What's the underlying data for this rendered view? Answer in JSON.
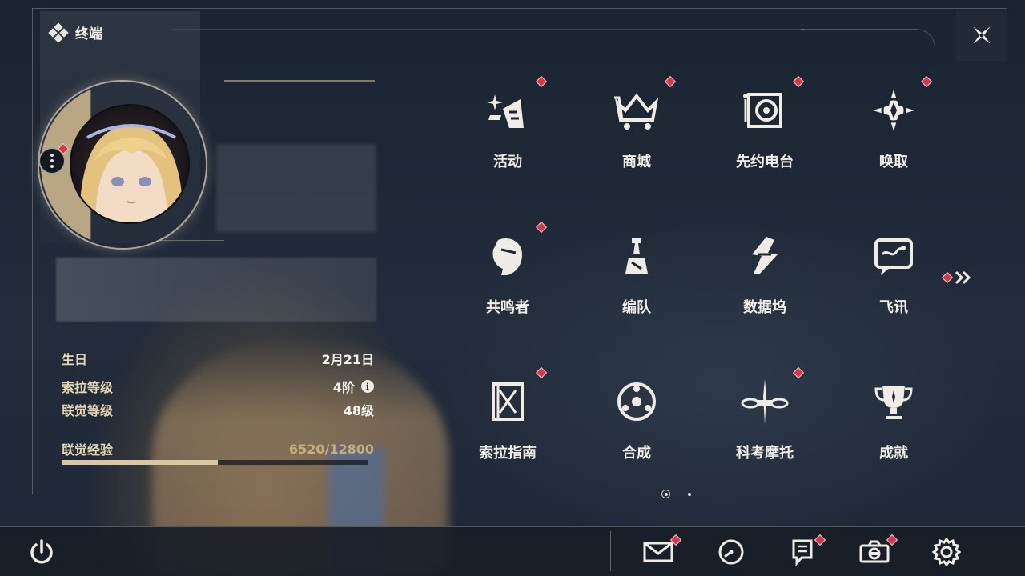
{
  "header": {
    "title": "终端"
  },
  "profile": {
    "birthday_label": "生日",
    "birthday_value": "2月21日",
    "sola_level_label": "索拉等级",
    "sola_level_value": "4阶",
    "union_level_label": "联觉等级",
    "union_level_value": "48级",
    "exp_label": "联觉经验",
    "exp_value": "6520/12800",
    "exp_progress": 0.509
  },
  "menu": {
    "tiles": [
      {
        "label": "活动",
        "icon": "event-sparkle-icon",
        "badge": true
      },
      {
        "label": "商城",
        "icon": "shop-crown-icon",
        "badge": true
      },
      {
        "label": "先约电台",
        "icon": "radio-icon",
        "badge": true
      },
      {
        "label": "唤取",
        "icon": "compass-star-icon",
        "badge": true
      },
      {
        "label": "共鸣者",
        "icon": "resonator-profile-icon",
        "badge": true
      },
      {
        "label": "编队",
        "icon": "chess-team-icon",
        "badge": false
      },
      {
        "label": "数据坞",
        "icon": "data-dock-icon",
        "badge": false
      },
      {
        "label": "飞讯",
        "icon": "message-chat-icon",
        "badge": false
      },
      {
        "label": "索拉指南",
        "icon": "guide-book-icon",
        "badge": true
      },
      {
        "label": "合成",
        "icon": "synthesis-icon",
        "badge": false
      },
      {
        "label": "科考摩托",
        "icon": "motorbike-icon",
        "badge": true
      },
      {
        "label": "成就",
        "icon": "trophy-icon",
        "badge": false
      }
    ],
    "pagination": {
      "current": 1,
      "total": 2
    }
  },
  "bottom_bar": {
    "buttons": [
      {
        "icon": "power-icon",
        "badge": false
      },
      {
        "icon": "mail-icon",
        "badge": true
      },
      {
        "icon": "clock-icon",
        "badge": false
      },
      {
        "icon": "notice-icon",
        "badge": true
      },
      {
        "icon": "camera-icon",
        "badge": true
      },
      {
        "icon": "settings-gear-icon",
        "badge": false
      }
    ]
  },
  "colors": {
    "badge_red": "#d6384a",
    "gold_label": "#e6d6b4",
    "exp_gold": "#c8ad7d",
    "text": "#f0eee8"
  }
}
